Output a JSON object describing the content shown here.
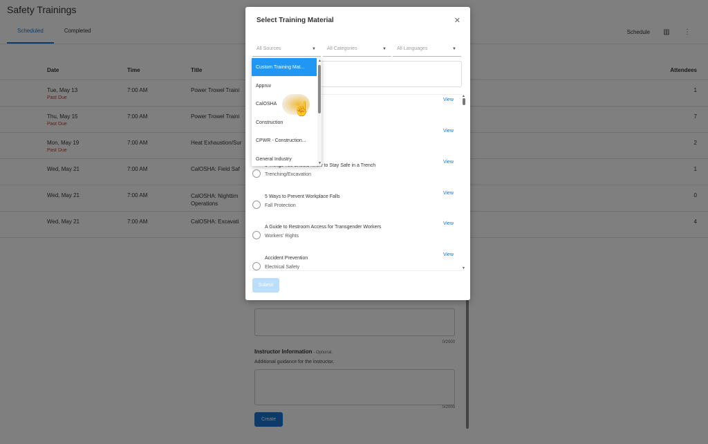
{
  "page": {
    "title": "Safety Trainings",
    "tabs": [
      {
        "label": "Scheduled",
        "active": true
      },
      {
        "label": "Completed",
        "active": false
      }
    ],
    "actions": {
      "schedule_label": "Schedule",
      "columns_icon": "columns-icon",
      "more_icon": "more-vert-icon"
    }
  },
  "table": {
    "headers": {
      "date": "Date",
      "time": "Time",
      "title": "Title",
      "attendees": "Attendees"
    },
    "rows": [
      {
        "date": "Tue, May 13",
        "status": "Past Due",
        "time": "7:00 AM",
        "title": "Power Trowel Traini",
        "attendees": "1"
      },
      {
        "date": "Thu, May 15",
        "status": "Past Due",
        "time": "7:00 AM",
        "title": "Power Trowel Traini",
        "attendees": "7"
      },
      {
        "date": "Mon, May 19",
        "status": "Past Due",
        "time": "7:00 AM",
        "title": "Heat Exhaustion/Sur",
        "attendees": "2"
      },
      {
        "date": "Wed, May 21",
        "status": "",
        "time": "7:00 AM",
        "title": "CalOSHA: Field Saf",
        "attendees": "1"
      },
      {
        "date": "Wed, May 21",
        "status": "",
        "time": "7:00 AM",
        "title": "CalOSHA: Nighttim",
        "title2": "Operations",
        "attendees": "0"
      },
      {
        "date": "Wed, May 21",
        "status": "",
        "time": "7:00 AM",
        "title": "CalOSHA: Excavati",
        "attendees": "4"
      }
    ]
  },
  "form": {
    "counter1": "0/2000",
    "instructor_label": "Instructor Information",
    "instructor_optional": " - Optional.",
    "instructor_help": "Additional guidance for the instructor.",
    "counter2": "0/2000",
    "create_label": "Create"
  },
  "modal": {
    "title": "Select Training Material",
    "close_icon": "close-icon",
    "filters": {
      "sources_placeholder": "All Sources",
      "categories_placeholder": "All Categories",
      "languages_placeholder": "All Languages"
    },
    "view_label": "View",
    "items": [
      {
        "title": "",
        "category": ""
      },
      {
        "title": "",
        "category": ""
      },
      {
        "title": "5 Things You Should Know to Stay Safe in a Trench",
        "category": "Trenching/Excavation"
      },
      {
        "title": "5 Ways to Prevent Workplace Falls",
        "category": "Fall Protection"
      },
      {
        "title": "A Guide to Restroom Access for Transgender Workers",
        "category": "Workers' Rights"
      },
      {
        "title": "Accident Prevention",
        "category": "Electrical Safety"
      }
    ],
    "submit_label": "Submit"
  },
  "dropdown": {
    "options": [
      {
        "label": "Custom Training Mat...",
        "selected": true
      },
      {
        "label": "Appruv",
        "selected": false
      },
      {
        "label": "CalOSHA",
        "selected": false
      },
      {
        "label": "Construction",
        "selected": false
      },
      {
        "label": "CPWR - Construction...",
        "selected": false
      },
      {
        "label": "General Industry",
        "selected": false
      }
    ]
  },
  "colors": {
    "accent": "#1976d2",
    "selected_option": "#2196f3",
    "past_due": "#d32f2f",
    "cursor_highlight": "#f0b41e"
  }
}
